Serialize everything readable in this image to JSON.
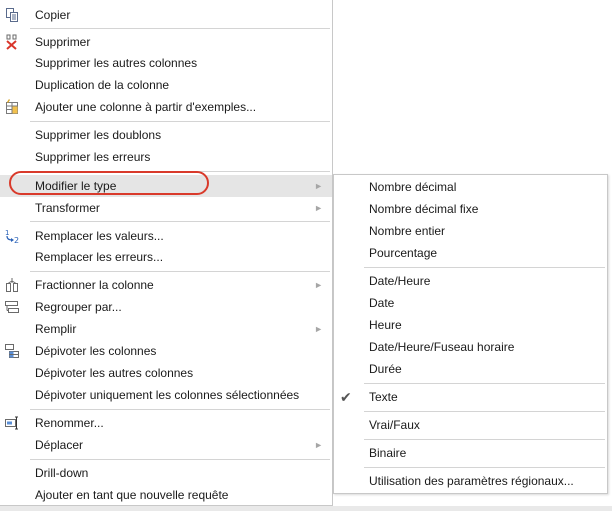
{
  "main_menu": {
    "items": [
      {
        "name": "copy",
        "label": "Copier",
        "icon": "copy-icon"
      },
      {
        "name": "delete",
        "label": "Supprimer",
        "icon": "delete-column-icon"
      },
      {
        "name": "delete-others",
        "label": "Supprimer les autres colonnes"
      },
      {
        "name": "duplicate",
        "label": "Duplication de la colonne"
      },
      {
        "name": "add-from-examples",
        "label": "Ajouter une colonne à partir d'exemples...",
        "icon": "column-from-examples-icon"
      },
      {
        "name": "remove-duplicates",
        "label": "Supprimer les doublons"
      },
      {
        "name": "remove-errors",
        "label": "Supprimer les erreurs"
      },
      {
        "name": "change-type",
        "label": "Modifier le type",
        "submenu": true
      },
      {
        "name": "transform",
        "label": "Transformer",
        "submenu": true
      },
      {
        "name": "replace-values",
        "label": "Remplacer les valeurs...",
        "icon": "replace-values-icon"
      },
      {
        "name": "replace-errors",
        "label": "Remplacer les erreurs..."
      },
      {
        "name": "split-column",
        "label": "Fractionner la colonne",
        "submenu": true,
        "icon": "split-column-icon"
      },
      {
        "name": "group-by",
        "label": "Regrouper par...",
        "icon": "group-by-icon"
      },
      {
        "name": "fill",
        "label": "Remplir",
        "submenu": true
      },
      {
        "name": "unpivot",
        "label": "Dépivoter les colonnes",
        "icon": "unpivot-icon"
      },
      {
        "name": "unpivot-others",
        "label": "Dépivoter les autres colonnes"
      },
      {
        "name": "unpivot-selected",
        "label": "Dépivoter uniquement les colonnes sélectionnées"
      },
      {
        "name": "rename",
        "label": "Renommer...",
        "icon": "rename-icon"
      },
      {
        "name": "move",
        "label": "Déplacer",
        "submenu": true
      },
      {
        "name": "drill-down",
        "label": "Drill-down"
      },
      {
        "name": "add-as-query",
        "label": "Ajouter en tant que nouvelle requête"
      }
    ]
  },
  "sub_menu": {
    "items": [
      {
        "label": "Nombre décimal"
      },
      {
        "label": "Nombre décimal fixe"
      },
      {
        "label": "Nombre entier"
      },
      {
        "label": "Pourcentage"
      },
      {
        "label": "Date/Heure"
      },
      {
        "label": "Date"
      },
      {
        "label": "Heure"
      },
      {
        "label": "Date/Heure/Fuseau horaire"
      },
      {
        "label": "Durée"
      },
      {
        "label": "Texte",
        "checked": true
      },
      {
        "label": "Vrai/Faux"
      },
      {
        "label": "Binaire"
      },
      {
        "label": "Utilisation des paramètres régionaux..."
      }
    ]
  },
  "icons": {
    "submenu_arrow": "►",
    "checkmark": "✔",
    "replace_icon_digits": "12"
  },
  "colors": {
    "highlight_oval": "#d93a2b",
    "selected_row": "#e5e5e5",
    "separator": "#d4d4d4"
  }
}
